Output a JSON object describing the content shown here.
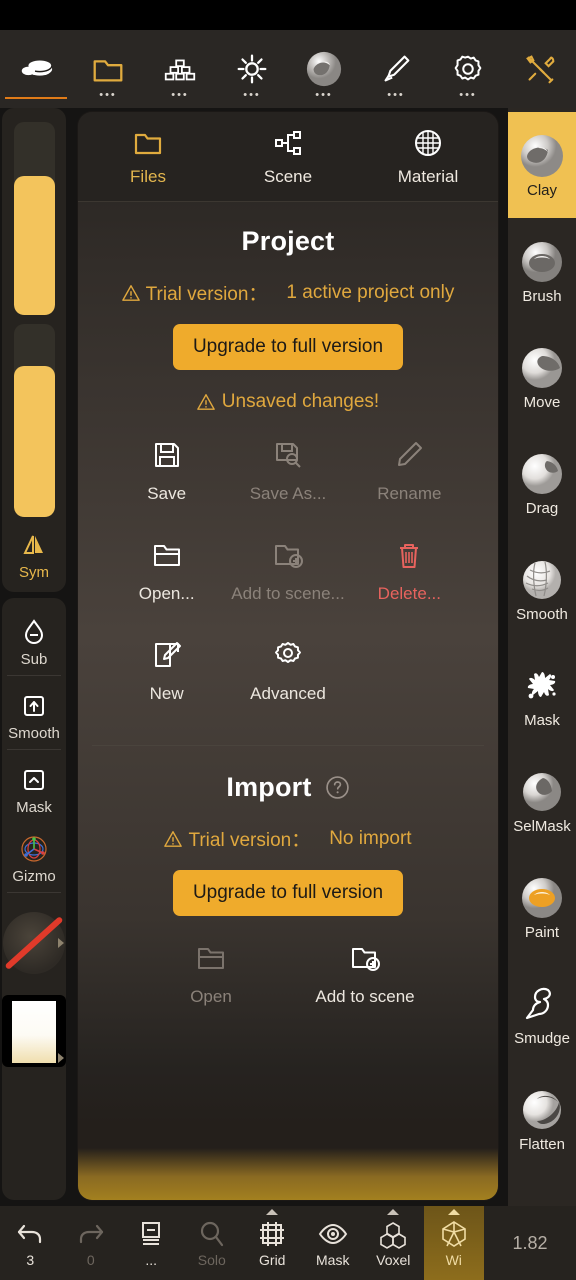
{
  "app": {
    "version_label": "1.82"
  },
  "topbar": {
    "items": [
      {
        "name": "sculpt",
        "icon": "clay-sculpt-icon",
        "active": true,
        "dots": false,
        "gold": false
      },
      {
        "name": "files",
        "icon": "folder-icon",
        "active": false,
        "dots": true,
        "gold": true
      },
      {
        "name": "scene",
        "icon": "stack-icon",
        "active": false,
        "dots": true,
        "gold": false
      },
      {
        "name": "light",
        "icon": "sun-icon",
        "active": false,
        "dots": true,
        "gold": false
      },
      {
        "name": "material",
        "icon": "material-sphere-icon",
        "active": false,
        "dots": true,
        "gold": false
      },
      {
        "name": "paint",
        "icon": "brush-icon",
        "active": false,
        "dots": true,
        "gold": false
      },
      {
        "name": "settings",
        "icon": "gear-icon",
        "active": false,
        "dots": true,
        "gold": false
      },
      {
        "name": "tools",
        "icon": "tools-icon",
        "active": false,
        "dots": false,
        "gold": true
      }
    ]
  },
  "leftbar": {
    "sliders": [
      {
        "name": "brush-size-slider",
        "fill_pct": 72
      },
      {
        "name": "brush-intensity-slider",
        "fill_pct": 78
      }
    ],
    "sym_label": "Sym",
    "buttons": [
      {
        "name": "sub",
        "label": "Sub",
        "icon": "drop-minus-icon"
      },
      {
        "name": "smooth",
        "label": "Smooth",
        "icon": "square-up-arrow-icon"
      },
      {
        "name": "mask",
        "label": "Mask",
        "icon": "square-chevron-up-icon"
      },
      {
        "name": "gizmo",
        "label": "Gizmo",
        "icon": "gizmo-axes-icon"
      }
    ]
  },
  "rightbar": {
    "tools": [
      {
        "label": "Clay",
        "icon": "clay-sphere-icon",
        "active": true
      },
      {
        "label": "Brush",
        "icon": "brush-sphere-icon",
        "active": false
      },
      {
        "label": "Move",
        "icon": "move-sphere-icon",
        "active": false
      },
      {
        "label": "Drag",
        "icon": "drag-sphere-icon",
        "active": false
      },
      {
        "label": "Smooth",
        "icon": "smooth-sphere-icon",
        "active": false
      },
      {
        "label": "Mask",
        "icon": "mask-splat-icon",
        "active": false
      },
      {
        "label": "SelMask",
        "icon": "selmask-sphere-icon",
        "active": false
      },
      {
        "label": "Paint",
        "icon": "paint-sphere-icon",
        "active": false
      },
      {
        "label": "Smudge",
        "icon": "smudge-icon",
        "active": false
      },
      {
        "label": "Flatten",
        "icon": "flatten-sphere-icon",
        "active": false
      }
    ]
  },
  "panel": {
    "tabs": [
      {
        "label": "Files",
        "icon": "folder-icon",
        "active": true
      },
      {
        "label": "Scene",
        "icon": "share-nodes-icon",
        "active": false
      },
      {
        "label": "Material",
        "icon": "material-globe-icon",
        "active": false
      }
    ],
    "project": {
      "title": "Project",
      "trial_prefix": "Trial version：",
      "trial_value": "1 active project only",
      "upgrade_label": "Upgrade to full version",
      "unsaved_label": "Unsaved changes!",
      "actions": [
        {
          "label": "Save",
          "icon": "floppy-save-icon",
          "state": "normal"
        },
        {
          "label": "Save As...",
          "icon": "floppy-saveas-icon",
          "state": "disabled"
        },
        {
          "label": "Rename",
          "icon": "pencil-icon",
          "state": "disabled"
        },
        {
          "label": "Open...",
          "icon": "folder-open-icon",
          "state": "normal"
        },
        {
          "label": "Add to scene...",
          "icon": "folder-plus-icon",
          "state": "disabled"
        },
        {
          "label": "Delete...",
          "icon": "trash-icon",
          "state": "danger"
        },
        {
          "label": "New",
          "icon": "new-document-icon",
          "state": "normal"
        },
        {
          "label": "Advanced",
          "icon": "gear-icon",
          "state": "normal"
        }
      ]
    },
    "import": {
      "title": "Import",
      "help_icon": "question-circle-icon",
      "trial_prefix": "Trial version：",
      "trial_value": "No import",
      "upgrade_label": "Upgrade to full version",
      "actions": [
        {
          "label": "Open",
          "icon": "folder-open-icon",
          "state": "disabled"
        },
        {
          "label": "Add to scene",
          "icon": "folder-plus-icon",
          "state": "normal"
        }
      ]
    }
  },
  "bottombar": {
    "items": [
      {
        "label": "3",
        "icon": "undo-icon",
        "state": "normal",
        "caret": false
      },
      {
        "label": "0",
        "icon": "redo-icon",
        "state": "disabled",
        "caret": false
      },
      {
        "label": "...",
        "icon": "layers-icon",
        "state": "dots",
        "caret": false
      },
      {
        "label": "Solo",
        "icon": "magnifier-icon",
        "state": "disabled",
        "caret": false
      },
      {
        "label": "Grid",
        "icon": "grid-frame-icon",
        "state": "normal",
        "caret": true
      },
      {
        "label": "Mask",
        "icon": "eye-icon",
        "state": "normal",
        "caret": false
      },
      {
        "label": "Voxel",
        "icon": "voxel-cubes-icon",
        "state": "normal",
        "caret": true
      },
      {
        "label": "Wi",
        "icon": "wireframe-icon",
        "state": "highlight",
        "caret": true
      }
    ],
    "version": "1.82"
  },
  "colors": {
    "accent_gold": "#efab2c",
    "panel_gold": "#e3b64e",
    "danger_red": "#e8635e",
    "slider_fill": "#f3c45c",
    "active_tool_bg": "#f0c152"
  }
}
